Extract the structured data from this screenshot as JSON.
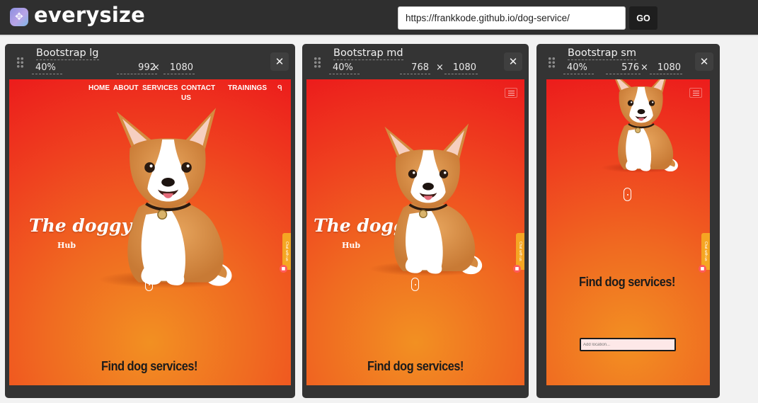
{
  "app": {
    "name": "everysize",
    "logo_icon": "move-arrows-icon"
  },
  "url_bar": {
    "value": "https://frankkode.github.io/dog-service/",
    "go_label": "GO"
  },
  "panels": [
    {
      "title": "Bootstrap lg",
      "zoom": "40%",
      "width": "992",
      "height": "1080",
      "times": "×",
      "close": "✕"
    },
    {
      "title": "Bootstrap md",
      "zoom": "40%",
      "width": "768",
      "height": "1080",
      "times": "×",
      "close": "✕"
    },
    {
      "title": "Bootstrap sm",
      "zoom": "40%",
      "width": "576",
      "height": "1080",
      "times": "×",
      "close": "✕"
    }
  ],
  "site": {
    "nav": {
      "home": "HOME",
      "about": "ABOUT",
      "services": "SERVICES",
      "contact_line1": "CONTACT",
      "contact_line2": "US",
      "trainings": "TRAININGS",
      "extra_icon": "user-icon"
    },
    "hero_title": "The doggy",
    "hero_sub": "Hub",
    "find_text": "Find dog services!",
    "location_placeholder": "Add location...",
    "chat_label": "Chat with us",
    "colors": {
      "background": "#ec1c1c",
      "glow": "#f29022",
      "chat": "#f5a623"
    }
  }
}
